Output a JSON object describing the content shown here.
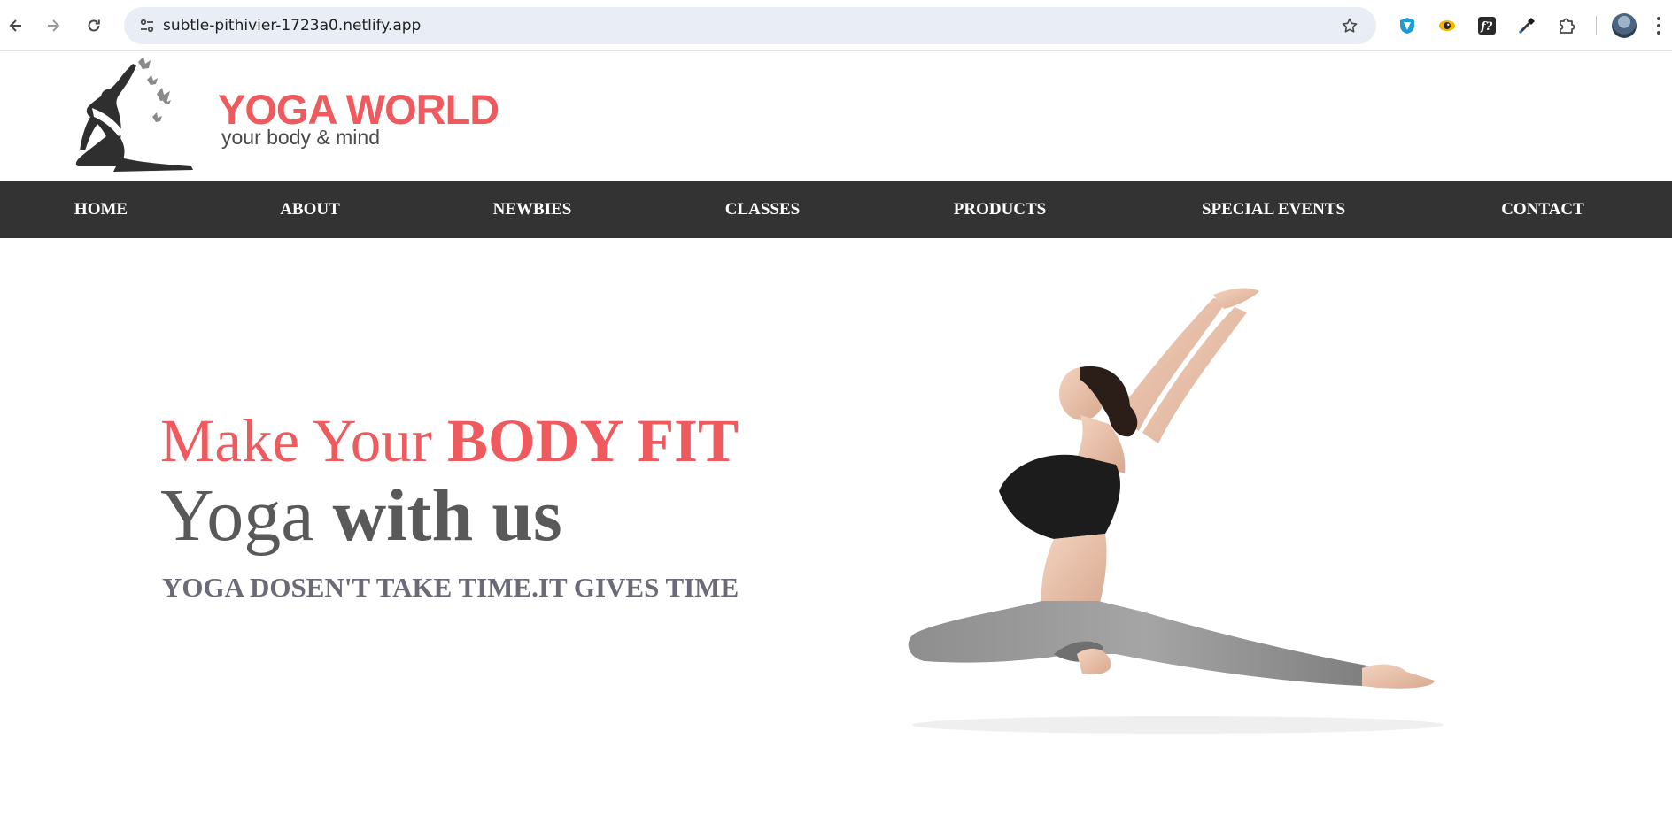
{
  "browser": {
    "url": "subtle-pithivier-1723a0.netlify.app",
    "icons": [
      "back-arrow-icon",
      "forward-arrow-icon",
      "reload-icon",
      "site-info-icon",
      "bookmark-star-icon",
      "shield-extension-icon",
      "eye-extension-icon",
      "font-extension-icon",
      "eyedropper-extension-icon",
      "puzzle-extensions-icon",
      "profile-avatar",
      "more-menu-icon"
    ]
  },
  "site": {
    "brand": {
      "title": "YOGA WORLD",
      "tagline": "your body & mind"
    },
    "nav": [
      {
        "label": "HOME"
      },
      {
        "label": "ABOUT"
      },
      {
        "label": "NEWBIES"
      },
      {
        "label": "CLASSES"
      },
      {
        "label": "PRODUCTS"
      },
      {
        "label": "SPECIAL EVENTS"
      },
      {
        "label": "CONTACT"
      }
    ],
    "hero": {
      "line1_regular": "Make Your ",
      "line1_bold": "BODY FIT",
      "line2_regular": "Yoga ",
      "line2_bold": "with us",
      "tagline": "YOGA DOSEN'T TAKE TIME.IT GIVES TIME"
    }
  },
  "colors": {
    "accent": "#ee5a5e",
    "navbar_bg": "#333333",
    "heading_gray": "#595959",
    "tagline_gray": "#6b6b78",
    "omnibox_bg": "#e9edf6"
  }
}
